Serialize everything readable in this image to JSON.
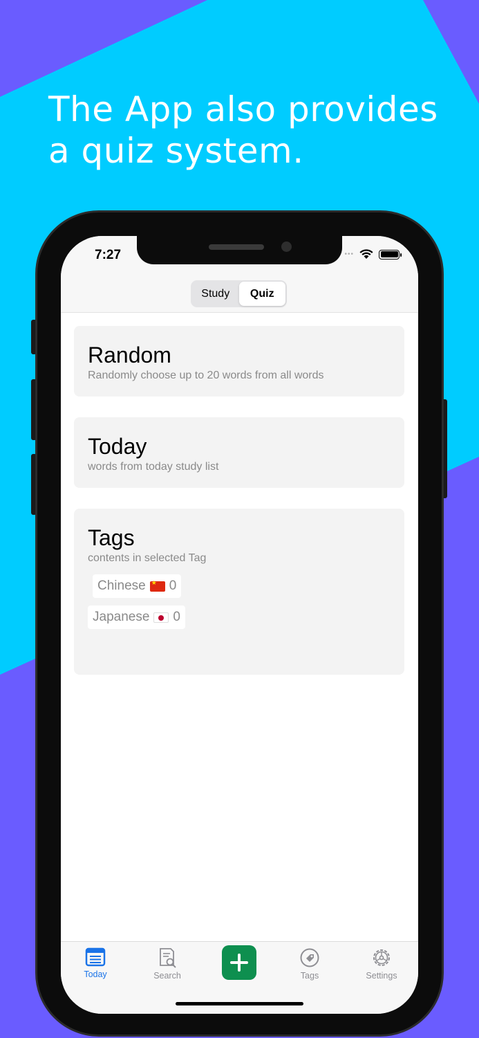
{
  "headline": "The App also provides a quiz system.",
  "colors": {
    "background_purple": "#6a5cff",
    "background_cyan": "#00ccff",
    "accent_blue": "#1a73e8",
    "add_green": "#0e8f4f"
  },
  "status_bar": {
    "time": "7:27",
    "icons": [
      "wifi-icon",
      "battery-icon"
    ]
  },
  "segmented": {
    "options": [
      "Study",
      "Quiz"
    ],
    "selected": "Quiz"
  },
  "cards": {
    "random": {
      "title": "Random",
      "subtitle": "Randomly choose up to 20 words from all words"
    },
    "today": {
      "title": "Today",
      "subtitle": "words from today study list"
    },
    "tags": {
      "title": "Tags",
      "subtitle": "contents in selected Tag",
      "items": [
        {
          "name": "Chinese",
          "flag": "china-flag-icon",
          "count": "0"
        },
        {
          "name": "Japanese",
          "flag": "japan-flag-icon",
          "count": "0"
        }
      ]
    }
  },
  "tabbar": {
    "items": [
      {
        "label": "Today",
        "icon": "today-list-icon",
        "active": true
      },
      {
        "label": "Search",
        "icon": "search-document-icon",
        "active": false
      },
      {
        "label": "",
        "icon": "plus-icon",
        "active": false
      },
      {
        "label": "Tags",
        "icon": "tag-icon",
        "active": false
      },
      {
        "label": "Settings",
        "icon": "gear-icon",
        "active": false
      }
    ]
  }
}
